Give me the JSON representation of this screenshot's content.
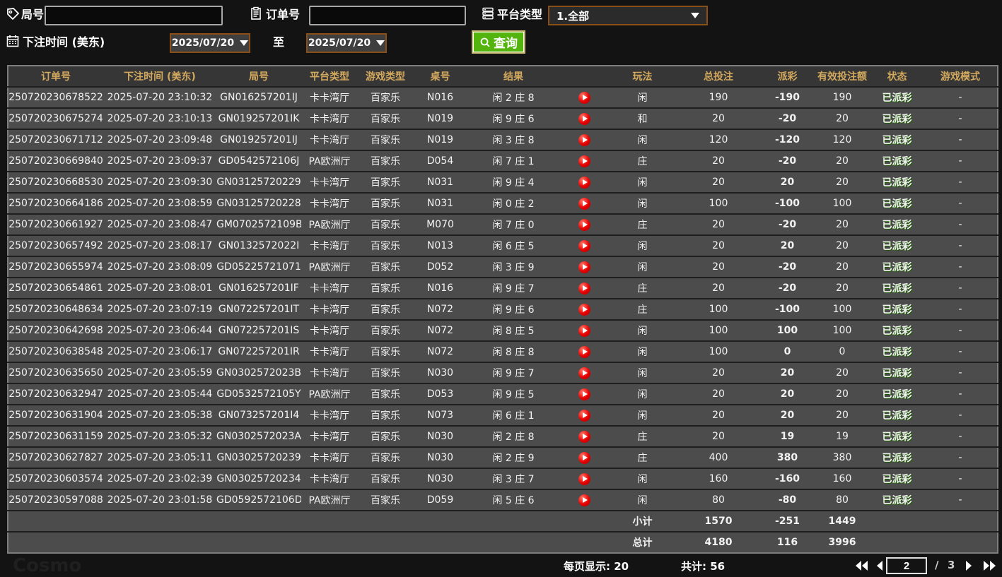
{
  "filters": {
    "round_label": "局号",
    "round_value": "",
    "order_label": "订单号",
    "order_value": "",
    "platform_label": "平台类型",
    "platform_value": "1.全部",
    "bet_time_label": "下注时间 (美东)",
    "date_from": "2025/07/20",
    "to_label": "至",
    "date_to": "2025/07/20",
    "search_label": "查询"
  },
  "icons": {
    "round": "tag-icon",
    "order": "clipboard-icon",
    "platform": "server-list-icon",
    "bet_time": "calendar-icon",
    "search": "magnifier-icon",
    "result": "play-video-icon",
    "pager": [
      "first-page-icon",
      "prev-page-icon",
      "next-page-icon",
      "last-page-icon"
    ]
  },
  "colors": {
    "accent_green": "#52b40d",
    "border_brown": "#8a4f16",
    "header_gold": "#d3a95e",
    "win_red": "#b8222a",
    "loss_green": "#3fd404",
    "total_yellow": "#e2e523",
    "status_green": "#2fd60a"
  },
  "table": {
    "headers": [
      "订单号",
      "下注时间 (美东)",
      "局号",
      "平台类型",
      "游戏类型",
      "桌号",
      "结果",
      "",
      "玩法",
      "总投注",
      "派彩",
      "有效投注额",
      "状态",
      "游戏模式"
    ],
    "rows": [
      {
        "order_id": "250720230678522",
        "bet_time": "2025-07-20 23:10:32",
        "round_id": "GN016257201IJ",
        "platform": "卡卡湾厅",
        "game_type": "百家乐",
        "table_no": "N016",
        "result": "闲 2 庄 8",
        "play": "闲",
        "total_bet": "190",
        "payout": "-190",
        "valid_bet": "190",
        "status": "已派彩",
        "game_mode": "-"
      },
      {
        "order_id": "250720230675274",
        "bet_time": "2025-07-20 23:10:13",
        "round_id": "GN019257201IK",
        "platform": "卡卡湾厅",
        "game_type": "百家乐",
        "table_no": "N019",
        "result": "闲 9 庄 6",
        "play": "和",
        "total_bet": "20",
        "payout": "-20",
        "valid_bet": "20",
        "status": "已派彩",
        "game_mode": "-"
      },
      {
        "order_id": "250720230671712",
        "bet_time": "2025-07-20 23:09:48",
        "round_id": "GN019257201IJ",
        "platform": "卡卡湾厅",
        "game_type": "百家乐",
        "table_no": "N019",
        "result": "闲 3 庄 8",
        "play": "闲",
        "total_bet": "120",
        "payout": "-120",
        "valid_bet": "120",
        "status": "已派彩",
        "game_mode": "-"
      },
      {
        "order_id": "250720230669840",
        "bet_time": "2025-07-20 23:09:37",
        "round_id": "GD0542572106J",
        "platform": "PA欧洲厅",
        "game_type": "百家乐",
        "table_no": "D054",
        "result": "闲 7 庄 1",
        "play": "庄",
        "total_bet": "20",
        "payout": "-20",
        "valid_bet": "20",
        "status": "已派彩",
        "game_mode": "-"
      },
      {
        "order_id": "250720230668530",
        "bet_time": "2025-07-20 23:09:30",
        "round_id": "GN03125720229",
        "platform": "卡卡湾厅",
        "game_type": "百家乐",
        "table_no": "N031",
        "result": "闲 9 庄 4",
        "play": "闲",
        "total_bet": "20",
        "payout": "20",
        "valid_bet": "20",
        "status": "已派彩",
        "game_mode": "-"
      },
      {
        "order_id": "250720230664186",
        "bet_time": "2025-07-20 23:08:59",
        "round_id": "GN03125720228",
        "platform": "卡卡湾厅",
        "game_type": "百家乐",
        "table_no": "N031",
        "result": "闲 0 庄 2",
        "play": "闲",
        "total_bet": "100",
        "payout": "-100",
        "valid_bet": "100",
        "status": "已派彩",
        "game_mode": "-"
      },
      {
        "order_id": "250720230661927",
        "bet_time": "2025-07-20 23:08:47",
        "round_id": "GM0702572109B",
        "platform": "PA欧洲厅",
        "game_type": "百家乐",
        "table_no": "M070",
        "result": "闲 7 庄 0",
        "play": "庄",
        "total_bet": "20",
        "payout": "-20",
        "valid_bet": "20",
        "status": "已派彩",
        "game_mode": "-"
      },
      {
        "order_id": "250720230657492",
        "bet_time": "2025-07-20 23:08:17",
        "round_id": "GN0132572022I",
        "platform": "卡卡湾厅",
        "game_type": "百家乐",
        "table_no": "N013",
        "result": "闲 6 庄 5",
        "play": "闲",
        "total_bet": "20",
        "payout": "20",
        "valid_bet": "20",
        "status": "已派彩",
        "game_mode": "-"
      },
      {
        "order_id": "250720230655974",
        "bet_time": "2025-07-20 23:08:09",
        "round_id": "GD05225721071",
        "platform": "PA欧洲厅",
        "game_type": "百家乐",
        "table_no": "D052",
        "result": "闲 3 庄 9",
        "play": "闲",
        "total_bet": "20",
        "payout": "-20",
        "valid_bet": "20",
        "status": "已派彩",
        "game_mode": "-"
      },
      {
        "order_id": "250720230654861",
        "bet_time": "2025-07-20 23:08:01",
        "round_id": "GN016257201IF",
        "platform": "卡卡湾厅",
        "game_type": "百家乐",
        "table_no": "N016",
        "result": "闲 9 庄 7",
        "play": "庄",
        "total_bet": "20",
        "payout": "-20",
        "valid_bet": "20",
        "status": "已派彩",
        "game_mode": "-"
      },
      {
        "order_id": "250720230648634",
        "bet_time": "2025-07-20 23:07:19",
        "round_id": "GN072257201IT",
        "platform": "卡卡湾厅",
        "game_type": "百家乐",
        "table_no": "N072",
        "result": "闲 9 庄 6",
        "play": "庄",
        "total_bet": "100",
        "payout": "-100",
        "valid_bet": "100",
        "status": "已派彩",
        "game_mode": "-"
      },
      {
        "order_id": "250720230642698",
        "bet_time": "2025-07-20 23:06:44",
        "round_id": "GN072257201IS",
        "platform": "卡卡湾厅",
        "game_type": "百家乐",
        "table_no": "N072",
        "result": "闲 8 庄 5",
        "play": "闲",
        "total_bet": "100",
        "payout": "100",
        "valid_bet": "100",
        "status": "已派彩",
        "game_mode": "-"
      },
      {
        "order_id": "250720230638548",
        "bet_time": "2025-07-20 23:06:17",
        "round_id": "GN072257201IR",
        "platform": "卡卡湾厅",
        "game_type": "百家乐",
        "table_no": "N072",
        "result": "闲 8 庄 8",
        "play": "闲",
        "total_bet": "100",
        "payout": "0",
        "valid_bet": "0",
        "status": "已派彩",
        "game_mode": "-"
      },
      {
        "order_id": "250720230635650",
        "bet_time": "2025-07-20 23:05:59",
        "round_id": "GN0302572023B",
        "platform": "卡卡湾厅",
        "game_type": "百家乐",
        "table_no": "N030",
        "result": "闲 9 庄 7",
        "play": "闲",
        "total_bet": "20",
        "payout": "20",
        "valid_bet": "20",
        "status": "已派彩",
        "game_mode": "-"
      },
      {
        "order_id": "250720230632947",
        "bet_time": "2025-07-20 23:05:44",
        "round_id": "GD0532572105Y",
        "platform": "PA欧洲厅",
        "game_type": "百家乐",
        "table_no": "D053",
        "result": "闲 9 庄 5",
        "play": "闲",
        "total_bet": "20",
        "payout": "20",
        "valid_bet": "20",
        "status": "已派彩",
        "game_mode": "-"
      },
      {
        "order_id": "250720230631904",
        "bet_time": "2025-07-20 23:05:38",
        "round_id": "GN073257201I4",
        "platform": "卡卡湾厅",
        "game_type": "百家乐",
        "table_no": "N073",
        "result": "闲 6 庄 1",
        "play": "闲",
        "total_bet": "20",
        "payout": "20",
        "valid_bet": "20",
        "status": "已派彩",
        "game_mode": "-"
      },
      {
        "order_id": "250720230631159",
        "bet_time": "2025-07-20 23:05:32",
        "round_id": "GN0302572023A",
        "platform": "卡卡湾厅",
        "game_type": "百家乐",
        "table_no": "N030",
        "result": "闲 2 庄 8",
        "play": "庄",
        "total_bet": "20",
        "payout": "19",
        "valid_bet": "19",
        "status": "已派彩",
        "game_mode": "-"
      },
      {
        "order_id": "250720230627827",
        "bet_time": "2025-07-20 23:05:11",
        "round_id": "GN03025720239",
        "platform": "卡卡湾厅",
        "game_type": "百家乐",
        "table_no": "N030",
        "result": "闲 2 庄 9",
        "play": "庄",
        "total_bet": "400",
        "payout": "380",
        "valid_bet": "380",
        "status": "已派彩",
        "game_mode": "-"
      },
      {
        "order_id": "250720230603574",
        "bet_time": "2025-07-20 23:02:39",
        "round_id": "GN03025720234",
        "platform": "卡卡湾厅",
        "game_type": "百家乐",
        "table_no": "N030",
        "result": "闲 3 庄 7",
        "play": "闲",
        "total_bet": "160",
        "payout": "-160",
        "valid_bet": "160",
        "status": "已派彩",
        "game_mode": "-"
      },
      {
        "order_id": "250720230597088",
        "bet_time": "2025-07-20 23:01:58",
        "round_id": "GD0592572106D",
        "platform": "PA欧洲厅",
        "game_type": "百家乐",
        "table_no": "D059",
        "result": "闲 5 庄 6",
        "play": "闲",
        "total_bet": "80",
        "payout": "-80",
        "valid_bet": "80",
        "status": "已派彩",
        "game_mode": "-"
      }
    ],
    "subtotal": {
      "label": "小计",
      "total_bet": "1570",
      "payout": "-251",
      "valid_bet": "1449"
    },
    "grand_total": {
      "label": "总计",
      "total_bet": "4180",
      "payout": "116",
      "valid_bet": "3996"
    }
  },
  "footer": {
    "per_page_label": "每页显示: 20",
    "total_label": "共计: 56",
    "current_page": "2",
    "page_separator": "/",
    "total_pages": "3"
  },
  "watermark": "Cosmo"
}
